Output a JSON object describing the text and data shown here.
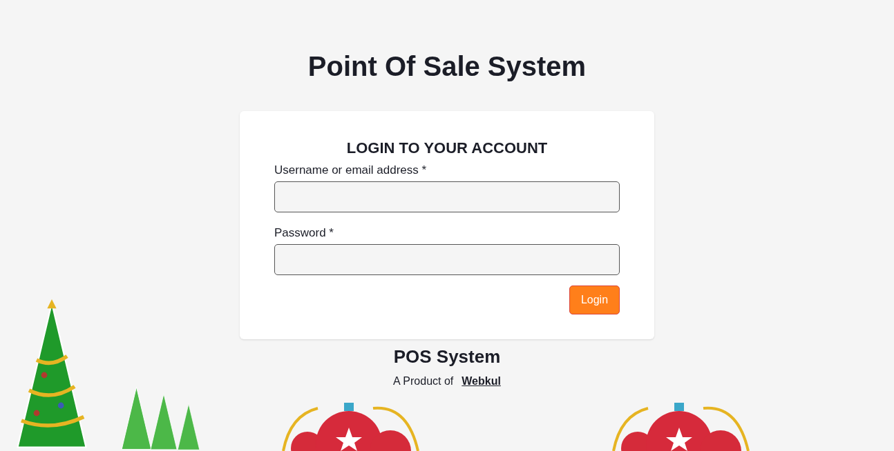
{
  "page_title": "Point Of Sale System",
  "login_card": {
    "heading": "LOGIN TO YOUR ACCOUNT",
    "fields": [
      {
        "label": "Username or email address *"
      },
      {
        "label": "Password *"
      }
    ],
    "button": "Login"
  },
  "footer": {
    "title": "POS System",
    "byline": "A Product of",
    "link": "Webkul"
  }
}
